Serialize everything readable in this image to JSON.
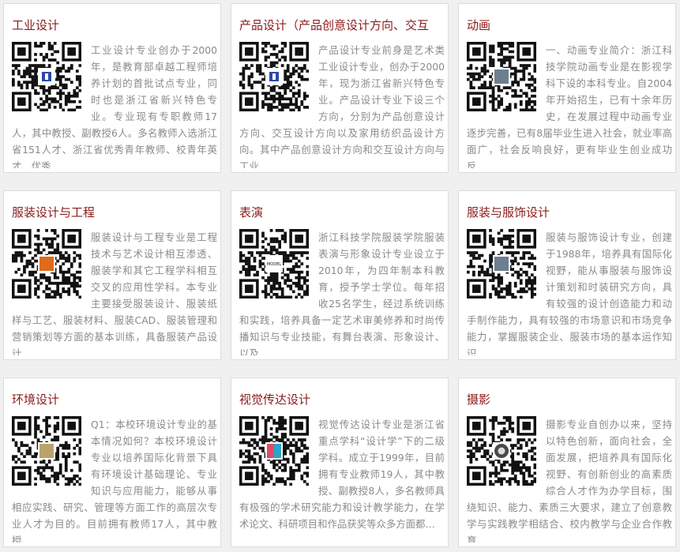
{
  "cards": [
    {
      "title": "工业设计",
      "text": "工业设计专业创办于2000年，是教育部卓越工程师培养计划的首批试点专业，同时也是浙江省新兴特色专业。专业现有专职教师17人，其中教授、副教授6人。多名教师入选浙江省151人才、浙江省优秀青年教师、校青年英才、优秀…",
      "qr_logo": "blue-logo"
    },
    {
      "title": "产品设计（产品创意设计方向、交互",
      "text": "产品设计专业前身是艺术类工业设计专业，创办于2000年，现为浙江省新兴特色专业。产品设计专业下设三个方向，分别为产品创意设计方向、交互设计方向以及家用纺织品设计方向。其中产品创意设计方向和交互设计方向与工业…",
      "qr_logo": "blue-logo"
    },
    {
      "title": "动画",
      "text": "一、动画专业简介：浙江科技学院动画专业是在影视学科下设的本科专业。自2004年开始招生，已有十余年历史，在发展过程中动画专业逐步完善，已有8届毕业生进入社会，就业率高面广，社会反响良好，更有毕业生创业成功反…",
      "qr_logo": "photo-logo"
    },
    {
      "title": "服装设计与工程",
      "text": "服装设计与工程专业是工程技术与艺术设计相互渗透、服装学和其它工程学科相互交叉的应用性学科。本专业主要接受服装设计、服装纸样与工艺、服装材料、服装CAD、服装管理和营销策划等方面的基本训练，具备服装产品设计…",
      "qr_logo": "orange-logo"
    },
    {
      "title": "表演",
      "text": "浙江科技学院服装学院服装表演与形象设计专业设立于2010年，为四年制本科教育，授予学士学位。每年招收25名学生，经过系统训练和实践，培养具备一定艺术审美修养和时尚传播知识与专业技能，有舞台表演、形象设计、以及…",
      "qr_logo": "text-logo",
      "qr_logo_text": "MODEL"
    },
    {
      "title": "服装与服饰设计",
      "text": "服装与服饰设计专业，创建于1988年，培养具有国际化视野，能从事服装与服饰设计策划和时装研究方向，具有较强的设计创造能力和动手制作能力，具有较强的市场意识和市场竞争能力，掌握服装企业、服装市场的基本运作知识…",
      "qr_logo": "photo-logo"
    },
    {
      "title": "环境设计",
      "text": "Q1：本校环境设计专业的基本情况如何？本校环境设计专业以培养国际化背景下具有环境设计基础理论、专业知识与应用能力，能够从事相应实践、研究、管理等方面工作的高层次专业人才为目的。目前拥有教师17人，其中教授、…",
      "qr_logo": "flower-logo"
    },
    {
      "title": "视觉传达设计",
      "text": "视觉传达设计专业是浙江省重点学科“设计学”下的二级学科。成立于1999年，目前拥有专业教师19人，其中教授、副教授8人，多名教师具有极强的学术研究能力和设计教学能力，在学术论文、科研项目和作品获奖等众多方面都…",
      "qr_logo": "color-logo"
    },
    {
      "title": "摄影",
      "text": "摄影专业自创办以来，坚持以特色创新，面向社会，全面发展，把培养具有国际化视野、有创新创业的高素质综合人才作为办学目标，围绕知识、能力、素质三大要求，建立了创意教学与实践教学相结合、校内教学与企业合作教育…",
      "qr_logo": "round-logo"
    }
  ]
}
